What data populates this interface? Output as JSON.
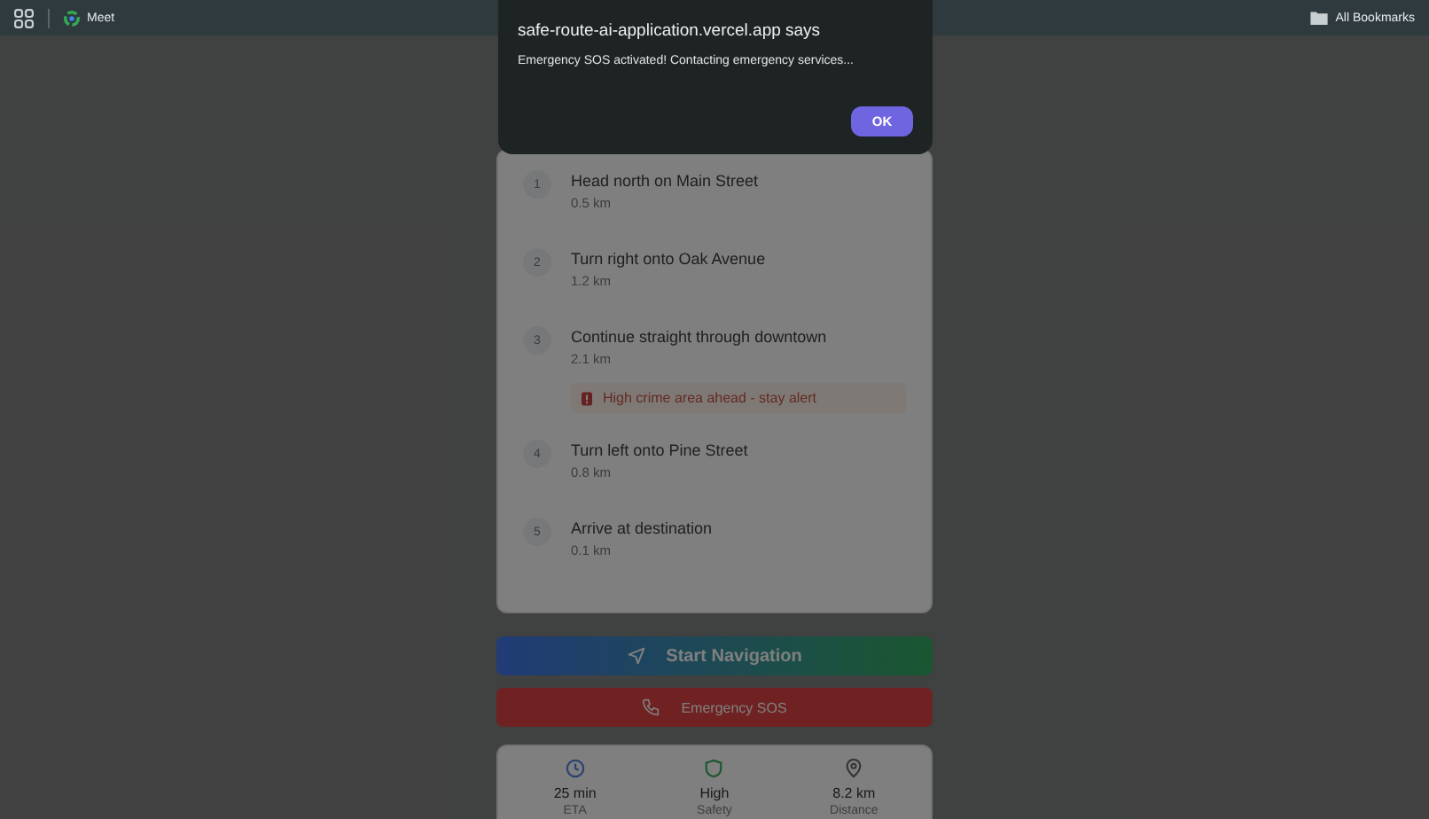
{
  "browser_bar": {
    "bookmark": "Meet",
    "all_bookmarks": "All Bookmarks"
  },
  "steps": [
    {
      "number": "1",
      "instruction": "Head north on Main Street",
      "distance": "0.5 km"
    },
    {
      "number": "2",
      "instruction": "Turn right onto Oak Avenue",
      "distance": "1.2 km"
    },
    {
      "number": "3",
      "instruction": "Continue straight through downtown",
      "distance": "2.1 km",
      "alert": "High crime area ahead - stay alert"
    },
    {
      "number": "4",
      "instruction": "Turn left onto Pine Street",
      "distance": "0.8 km"
    },
    {
      "number": "5",
      "instruction": "Arrive at destination",
      "distance": "0.1 km"
    }
  ],
  "buttons": {
    "start": "Start Navigation",
    "sos": "Emergency SOS"
  },
  "stats": [
    {
      "kind": "clock",
      "value": "25 min",
      "label": "ETA"
    },
    {
      "kind": "shield",
      "value": "High",
      "label": "Safety"
    },
    {
      "kind": "pin",
      "value": "8.2 km",
      "label": "Distance"
    }
  ],
  "dialog": {
    "title": "safe-route-ai-application.vercel.app says",
    "message": "Emergency SOS activated! Contacting emergency services...",
    "ok": "OK"
  }
}
